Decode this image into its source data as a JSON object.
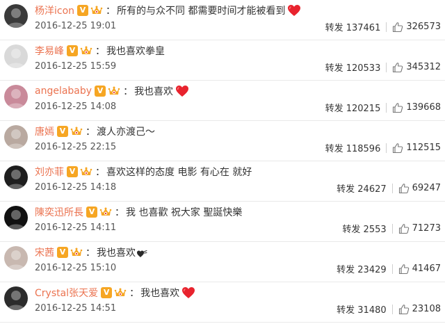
{
  "comments": [
    {
      "user": "杨洋icon",
      "separator": "：",
      "text": "所有的与众不同 都需要时间才能被看到",
      "heart": "big",
      "time": "2016-12-25 19:01",
      "repost_label": "转发",
      "reposts": "137461",
      "likes": "326573",
      "avatar_color": "#3a3a3a"
    },
    {
      "user": "李易峰",
      "separator": "：",
      "text": "我也喜欢拳皇",
      "heart": "",
      "time": "2016-12-25 15:59",
      "repost_label": "转发",
      "reposts": "120533",
      "likes": "345312",
      "avatar_color": "#d9d9d9"
    },
    {
      "user": "angelababy",
      "separator": "：",
      "text": "我也喜欢",
      "heart": "big",
      "time": "2016-12-25 14:08",
      "repost_label": "转发",
      "reposts": "120215",
      "likes": "139668",
      "avatar_color": "#c98a9a"
    },
    {
      "user": "唐嫣",
      "separator": "：",
      "text": "渡人亦渡己～",
      "heart": "",
      "time": "2016-12-25 22:15",
      "repost_label": "转发",
      "reposts": "118596",
      "likes": "112515",
      "avatar_color": "#b9a9a0"
    },
    {
      "user": "刘亦菲",
      "separator": "：",
      "text": "喜欢这样的态度 电影 有心在 就好",
      "heart": "",
      "time": "2016-12-25 14:18",
      "repost_label": "转发",
      "reposts": "24627",
      "likes": "69247",
      "avatar_color": "#1e1e1e"
    },
    {
      "user": "陳奕迅所長",
      "separator": "：",
      "text": "我 也喜歡 祝大家 聖誕快樂",
      "heart": "",
      "time": "2016-12-25 14:11",
      "repost_label": "转发",
      "reposts": "2553",
      "likes": "71273",
      "avatar_color": "#111111"
    },
    {
      "user": "宋茜",
      "separator": "：",
      "text": "我也喜欢",
      "heart": "small",
      "time": "2016-12-25 15:10",
      "repost_label": "转发",
      "reposts": "23429",
      "likes": "41467",
      "avatar_color": "#c8b8b0"
    },
    {
      "user": "Crystal张天爱",
      "separator": "：",
      "text": "我也喜欢",
      "heart": "big",
      "time": "2016-12-25 14:51",
      "repost_label": "转发",
      "reposts": "31480",
      "likes": "23108",
      "avatar_color": "#2c2c2c"
    }
  ],
  "badges": {
    "verified": "V"
  },
  "colors": {
    "username": "#eb7350",
    "heart": "#e8232e",
    "verified_badge": "#f6a623"
  },
  "icons": {
    "like": "thumb-up-icon",
    "heart": "heart-icon",
    "verified": "verified-v-icon",
    "vip": "vip-crown-icon"
  }
}
